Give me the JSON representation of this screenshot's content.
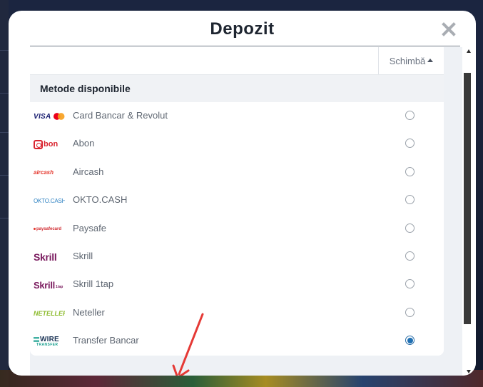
{
  "modal": {
    "title": "Depozit",
    "close_icon": "close-x-icon",
    "sort_label": "Schimbă",
    "section_title": "Metode disponibile"
  },
  "methods": [
    {
      "label": "Card Bancar & Revolut",
      "logo": "VISA",
      "selected": false
    },
    {
      "label": "Abon",
      "logo": "bon",
      "selected": false
    },
    {
      "label": "Aircash",
      "logo": "aircash",
      "selected": false
    },
    {
      "label": "OKTO.CASH",
      "logo": "OKTO.CASH",
      "selected": false
    },
    {
      "label": "Paysafe",
      "logo": "paysafecard",
      "selected": false
    },
    {
      "label": "Skrill",
      "logo": "Skrill",
      "selected": false
    },
    {
      "label": "Skrill 1tap",
      "logo": "Skrill",
      "logo_suffix": "1tap",
      "selected": false
    },
    {
      "label": "Neteller",
      "logo": "NETELLER",
      "selected": false
    },
    {
      "label": "Transfer Bancar",
      "logo": "WIRE",
      "logo_sub": "TRANSFER",
      "selected": true
    }
  ],
  "colors": {
    "accent": "#1f6fb2",
    "annotation_arrow": "#e53935",
    "skrill": "#7a1a5e",
    "neteller": "#8dbb2e"
  }
}
